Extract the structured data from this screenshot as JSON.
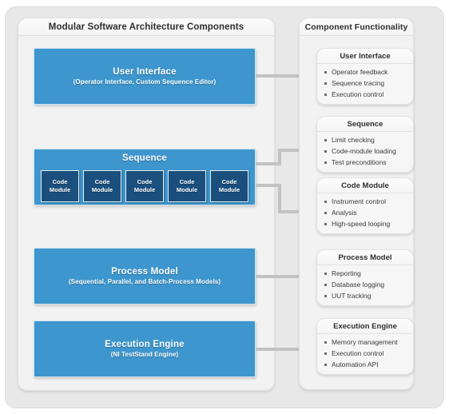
{
  "diagram": {
    "panels": {
      "left_title": "Modular Software Architecture Components",
      "right_title": "Component Functionality"
    },
    "colors": {
      "block_blue": "#3d96cd",
      "module_navy": "#1a4f7e",
      "panel_gray": "#f2f2f2",
      "frame_gray": "#e8e8e8",
      "connector_gray": "#c0c0c0"
    },
    "blocks": [
      {
        "id": "user-interface",
        "title": "User Interface",
        "subtitle": "(Operator Interface, Custom Sequence Editor)"
      },
      {
        "id": "sequence",
        "title": "Sequence",
        "subtitle": ""
      },
      {
        "id": "process-model",
        "title": "Process Model",
        "subtitle": "(Sequential, Parallel, and Batch-Process Models)"
      },
      {
        "id": "execution-engine",
        "title": "Execution Engine",
        "subtitle": "(NI TestStand Engine)"
      }
    ],
    "code_modules": [
      {
        "line1": "Code",
        "line2": "Module"
      },
      {
        "line1": "Code",
        "line2": "Module"
      },
      {
        "line1": "Code",
        "line2": "Module"
      },
      {
        "line1": "Code",
        "line2": "Module"
      },
      {
        "line1": "Code",
        "line2": "Module"
      }
    ],
    "functionality_cards": [
      {
        "id": "user-interface",
        "title": "User Interface",
        "items": [
          "Operator feedback",
          "Sequence tracing",
          "Execution control"
        ]
      },
      {
        "id": "sequence",
        "title": "Sequence",
        "items": [
          "Limit checking",
          "Code-module loading",
          "Test preconditions"
        ]
      },
      {
        "id": "code-module",
        "title": "Code Module",
        "items": [
          "Instrument control",
          "Analysis",
          "High-speed looping"
        ]
      },
      {
        "id": "process-model",
        "title": "Process Model",
        "items": [
          "Reporting",
          "Database logging",
          "UUT tracking"
        ]
      },
      {
        "id": "execution-engine",
        "title": "Execution Engine",
        "items": [
          "Memory management",
          "Execution control",
          "Automation API"
        ]
      }
    ]
  }
}
